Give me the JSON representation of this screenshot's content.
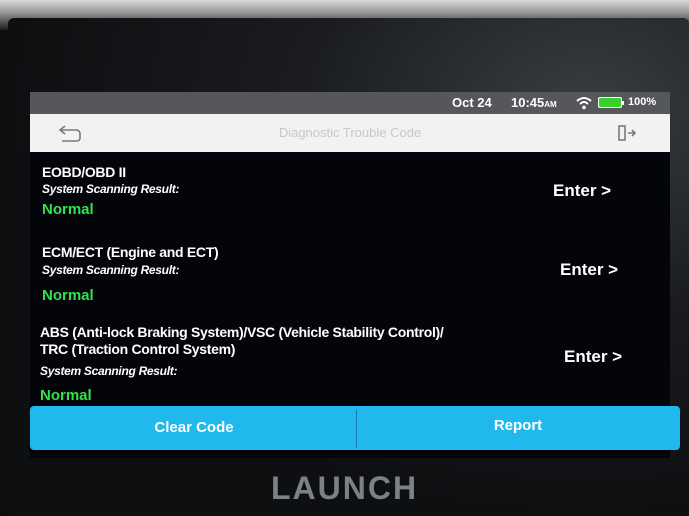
{
  "status_bar": {
    "date": "Oct 24",
    "time": "10:45",
    "ampm": "AM",
    "battery": "100%"
  },
  "title_bar": {
    "title": "Diagnostic Trouble Code"
  },
  "systems": [
    {
      "name": "EOBD/OBD II",
      "scan_label": "System Scanning Result:",
      "status": "Normal",
      "action": "Enter >"
    },
    {
      "name": "ECM/ECT (Engine and ECT)",
      "scan_label": "System Scanning Result:",
      "status": "Normal",
      "action": "Enter >"
    },
    {
      "name": "ABS (Anti-lock Braking System)/VSC (Vehicle Stability Control)/",
      "name_line2": "TRC (Traction Control System)",
      "scan_label": "System Scanning Result:",
      "status": "Normal",
      "action": "Enter >"
    }
  ],
  "bottom_bar": {
    "clear_code": "Clear Code",
    "report": "Report"
  },
  "brand": "LAUNCH",
  "colors": {
    "accent": "#21b8ee",
    "status_ok": "#2fe34a",
    "battery": "#36d12b"
  }
}
